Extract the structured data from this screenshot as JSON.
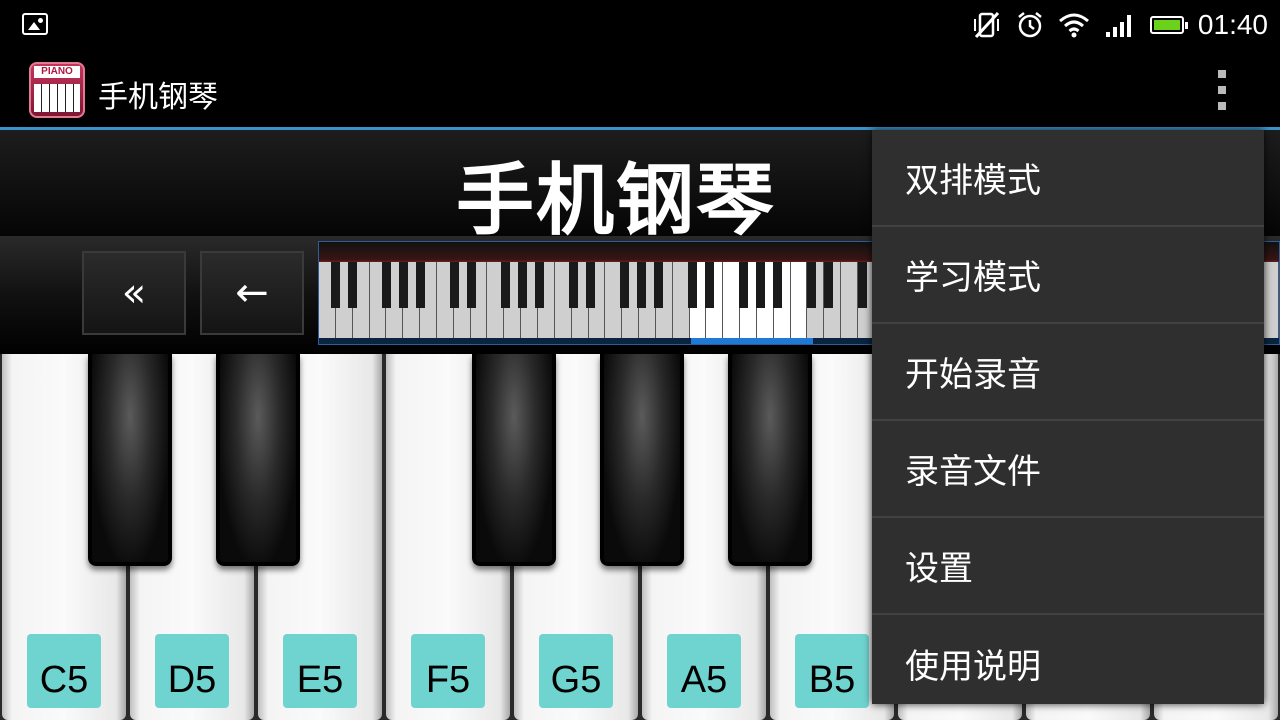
{
  "status_bar": {
    "time": "01:40",
    "icons": [
      "gallery-icon",
      "vibrate-off-icon",
      "alarm-icon",
      "wifi-icon",
      "signal-icon",
      "battery-icon"
    ],
    "battery_level_percent": 100,
    "battery_color": "#6bd21b"
  },
  "action_bar": {
    "title": "手机钢琴",
    "app_icon_label": "PIANO",
    "accent_color": "#3b94c9"
  },
  "banner": {
    "title": "手机钢琴"
  },
  "navigation": {
    "buttons": [
      {
        "icon": "fast-rewind-icon",
        "glyph": "«"
      },
      {
        "icon": "back-arrow-icon",
        "glyph": "←"
      }
    ]
  },
  "keyboard": {
    "white_keys": [
      {
        "note": "C5"
      },
      {
        "note": "D5"
      },
      {
        "note": "E5"
      },
      {
        "note": "F5"
      },
      {
        "note": "G5"
      },
      {
        "note": "A5"
      },
      {
        "note": "B5"
      }
    ],
    "label_color": "#6fd3cf"
  },
  "menu": {
    "items": [
      {
        "label": "双排模式"
      },
      {
        "label": "学习模式"
      },
      {
        "label": "开始录音"
      },
      {
        "label": "录音文件"
      },
      {
        "label": "设置"
      },
      {
        "label": "使用说明"
      }
    ]
  }
}
